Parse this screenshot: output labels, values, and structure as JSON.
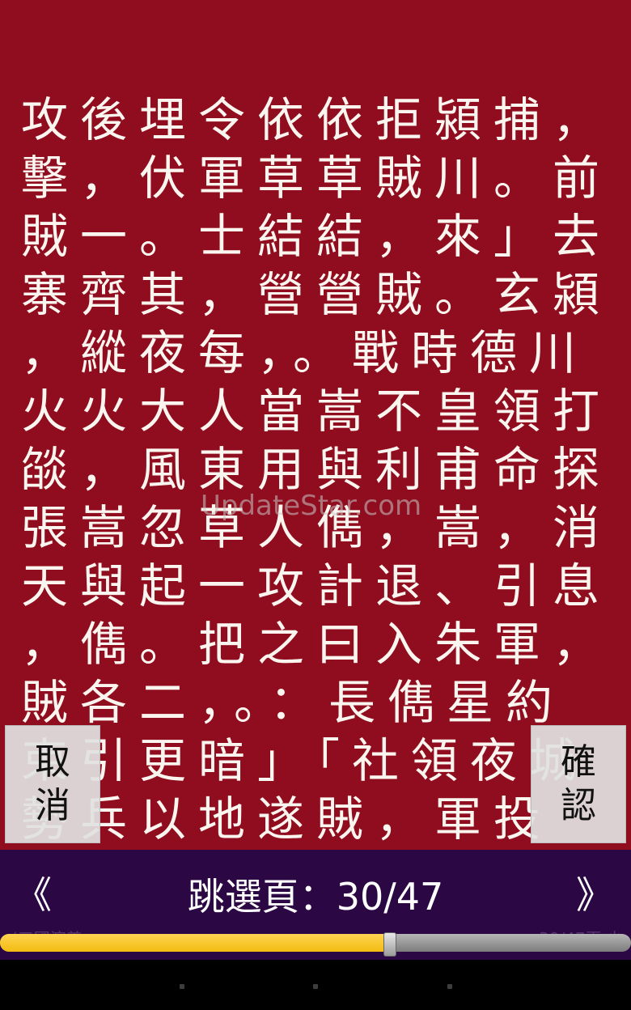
{
  "reader": {
    "lines": [
      "攻後埋令依依拒潁捕，",
      "擊，伏軍草草賊川。前",
      "賊一。士結結，來」去",
      "寨齊其，營營賊。玄潁",
      "，縱夜每，。戰時德川",
      "火火大人當嵩不皇領打",
      "燄，風東用與利甫命探",
      "張嵩忽草人儁，嵩，消",
      "天與起一攻計退、引息",
      "，儁。把之曰入朱軍，",
      "賊各二，。：長儁星約",
      "束引更暗」「社領夜城",
      "勢兵以地遂賊，軍投"
    ]
  },
  "watermark": "UpdateStar.com",
  "buttons": {
    "cancel_line1": "取",
    "cancel_line2": "消",
    "confirm_line1": "確",
    "confirm_line2": "認"
  },
  "jumpbar": {
    "prev_icon": "《",
    "next_icon": "》",
    "label": "跳選頁：30/47",
    "hint_left": "(三國演義",
    "hint_right": "30/47頁 少"
  },
  "slider": {
    "current_page": 30,
    "total_pages": 47,
    "fill_color": "#f2bc10",
    "track_color": "#9e9e9e"
  },
  "colors": {
    "page_background": "#8f0d1e",
    "text": "#fbf5ef",
    "jumpbar_background": "#2b0744"
  }
}
